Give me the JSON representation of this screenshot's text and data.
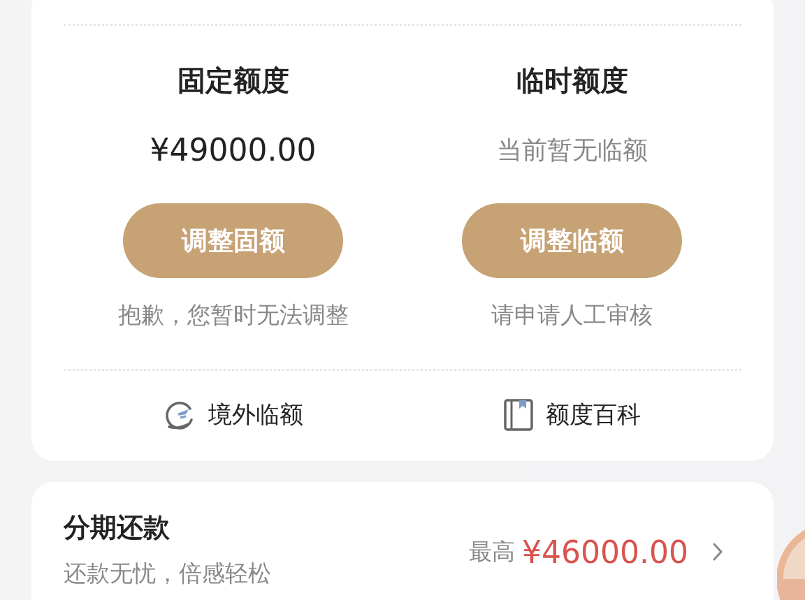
{
  "limits": [
    {
      "title": "固定额度",
      "amount": "¥49000.00",
      "kind": "value",
      "button": "调整固额",
      "note": "抱歉，您暂时无法调整"
    },
    {
      "title": "临时额度",
      "amount": "当前暂无临额",
      "kind": "empty",
      "button": "调整临额",
      "note": "请申请人工审核"
    }
  ],
  "links": [
    {
      "kind": "plane",
      "label": "境外临额"
    },
    {
      "kind": "book",
      "label": "额度百科"
    }
  ],
  "installment": {
    "title": "分期还款",
    "subtitle": "还款无忧，倍感轻松",
    "max_label": "最高",
    "max_amount": "¥46000.00"
  }
}
